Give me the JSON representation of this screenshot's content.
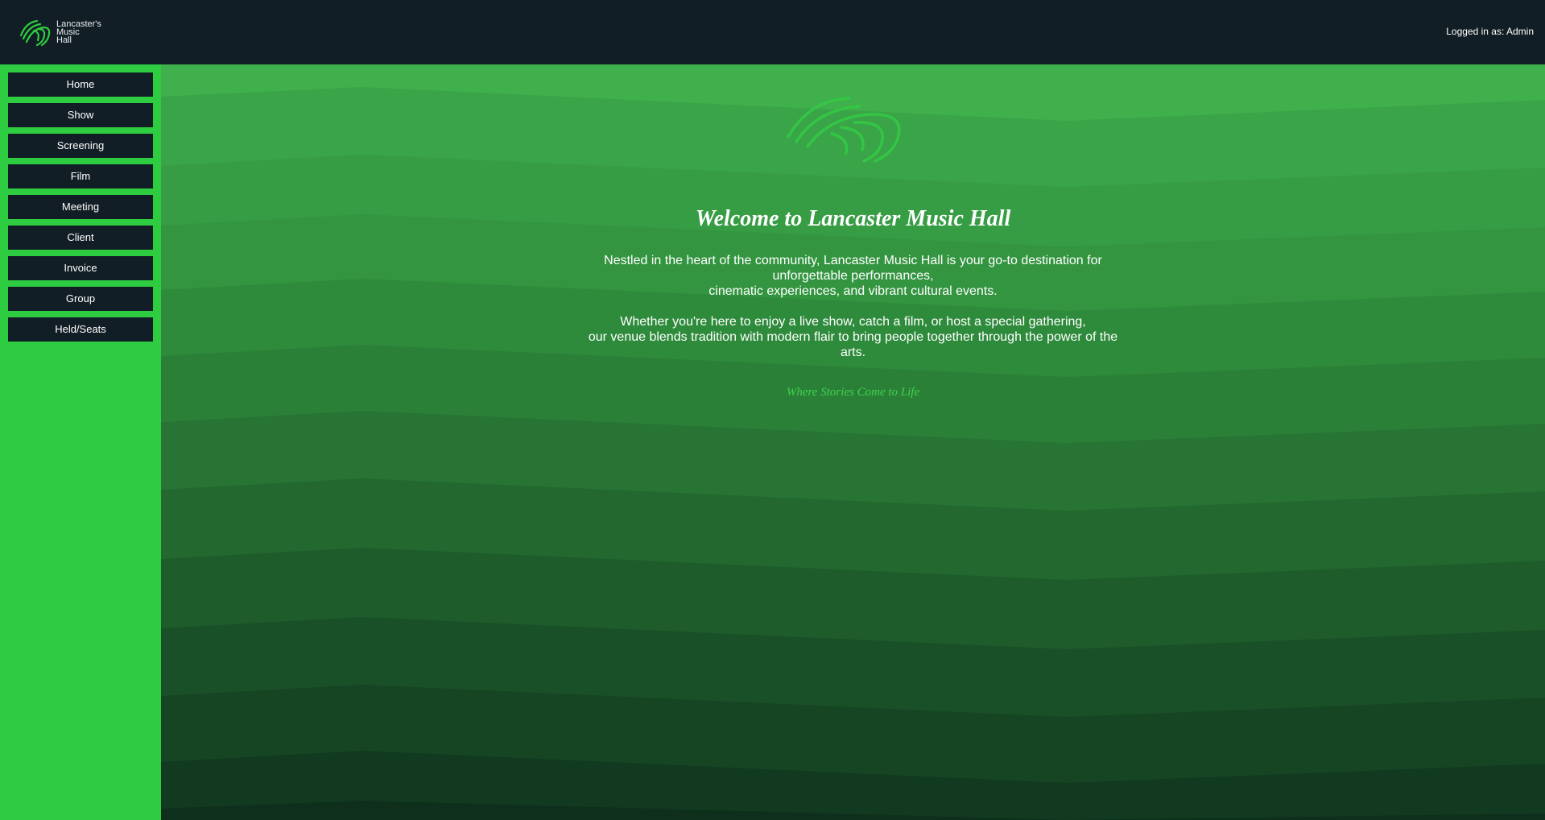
{
  "header": {
    "brand_text": "Lancaster's\nMusic\nHall",
    "user_label": "Logged in as: Admin"
  },
  "sidebar": {
    "items": [
      {
        "label": "Home"
      },
      {
        "label": "Show"
      },
      {
        "label": "Screening"
      },
      {
        "label": "Film"
      },
      {
        "label": "Meeting"
      },
      {
        "label": "Client"
      },
      {
        "label": "Invoice"
      },
      {
        "label": "Group"
      },
      {
        "label": "Held/Seats"
      }
    ]
  },
  "main": {
    "title": "Welcome to Lancaster Music Hall",
    "para1_line1": "Nestled in the heart of the community, Lancaster Music Hall is your go-to destination for",
    "para1_line2": "unforgettable performances,",
    "para1_line3": "cinematic experiences, and vibrant cultural events.",
    "para2_line1": "Whether you're here to enjoy a live show, catch a film, or host a special gathering,",
    "para2_line2": "our venue blends tradition with modern flair to bring people together through the power of the",
    "para2_line3": "arts.",
    "tagline": "Where Stories Come to Life"
  },
  "colors": {
    "header_bg": "#121e25",
    "sidebar_bg": "#2ecc40",
    "accent": "#2ecc40"
  },
  "icons": {
    "brand": "lancaster-logo-icon",
    "hero": "lancaster-logo-icon"
  }
}
